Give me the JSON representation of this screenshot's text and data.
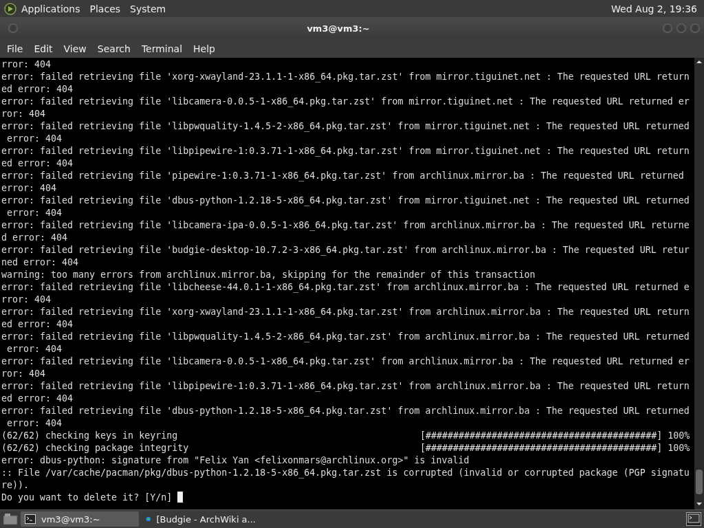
{
  "top_panel": {
    "menus": [
      "Applications",
      "Places",
      "System"
    ],
    "clock": "Wed Aug  2, 19:36"
  },
  "window": {
    "title": "vm3@vm3:~"
  },
  "menu_bar": [
    "File",
    "Edit",
    "View",
    "Search",
    "Terminal",
    "Help"
  ],
  "terminal": {
    "lines": [
      {
        "kind": "text",
        "text": "rror: 404"
      },
      {
        "kind": "text",
        "text": "error: failed retrieving file 'xorg-xwayland-23.1.1-1-x86_64.pkg.tar.zst' from mirror.tiguinet.net : The requested URL return"
      },
      {
        "kind": "text",
        "text": "ed error: 404"
      },
      {
        "kind": "text",
        "text": "error: failed retrieving file 'libcamera-0.0.5-1-x86_64.pkg.tar.zst' from mirror.tiguinet.net : The requested URL returned er"
      },
      {
        "kind": "text",
        "text": "ror: 404"
      },
      {
        "kind": "text",
        "text": "error: failed retrieving file 'libpwquality-1.4.5-2-x86_64.pkg.tar.zst' from mirror.tiguinet.net : The requested URL returned"
      },
      {
        "kind": "text",
        "text": " error: 404"
      },
      {
        "kind": "text",
        "text": "error: failed retrieving file 'libpipewire-1:0.3.71-1-x86_64.pkg.tar.zst' from mirror.tiguinet.net : The requested URL return"
      },
      {
        "kind": "text",
        "text": "ed error: 404"
      },
      {
        "kind": "text",
        "text": "error: failed retrieving file 'pipewire-1:0.3.71-1-x86_64.pkg.tar.zst' from archlinux.mirror.ba : The requested URL returned"
      },
      {
        "kind": "text",
        "text": "error: 404"
      },
      {
        "kind": "text",
        "text": "error: failed retrieving file 'dbus-python-1.2.18-5-x86_64.pkg.tar.zst' from mirror.tiguinet.net : The requested URL returned"
      },
      {
        "kind": "text",
        "text": " error: 404"
      },
      {
        "kind": "text",
        "text": "error: failed retrieving file 'libcamera-ipa-0.0.5-1-x86_64.pkg.tar.zst' from archlinux.mirror.ba : The requested URL returne"
      },
      {
        "kind": "text",
        "text": "d error: 404"
      },
      {
        "kind": "text",
        "text": "error: failed retrieving file 'budgie-desktop-10.7.2-3-x86_64.pkg.tar.zst' from archlinux.mirror.ba : The requested URL retur"
      },
      {
        "kind": "text",
        "text": "ned error: 404"
      },
      {
        "kind": "text",
        "text": "warning: too many errors from archlinux.mirror.ba, skipping for the remainder of this transaction"
      },
      {
        "kind": "text",
        "text": "error: failed retrieving file 'libcheese-44.0.1-1-x86_64.pkg.tar.zst' from archlinux.mirror.ba : The requested URL returned e"
      },
      {
        "kind": "text",
        "text": "rror: 404"
      },
      {
        "kind": "text",
        "text": "error: failed retrieving file 'xorg-xwayland-23.1.1-1-x86_64.pkg.tar.zst' from archlinux.mirror.ba : The requested URL return"
      },
      {
        "kind": "text",
        "text": "ed error: 404"
      },
      {
        "kind": "text",
        "text": "error: failed retrieving file 'libpwquality-1.4.5-2-x86_64.pkg.tar.zst' from archlinux.mirror.ba : The requested URL returned"
      },
      {
        "kind": "text",
        "text": " error: 404"
      },
      {
        "kind": "text",
        "text": "error: failed retrieving file 'libcamera-0.0.5-1-x86_64.pkg.tar.zst' from archlinux.mirror.ba : The requested URL returned er"
      },
      {
        "kind": "text",
        "text": "ror: 404"
      },
      {
        "kind": "text",
        "text": "error: failed retrieving file 'libpipewire-1:0.3.71-1-x86_64.pkg.tar.zst' from archlinux.mirror.ba : The requested URL return"
      },
      {
        "kind": "text",
        "text": "ed error: 404"
      },
      {
        "kind": "text",
        "text": "error: failed retrieving file 'dbus-python-1.2.18-5-x86_64.pkg.tar.zst' from archlinux.mirror.ba : The requested URL returned"
      },
      {
        "kind": "text",
        "text": " error: 404"
      },
      {
        "kind": "progress",
        "text": "(62/62) checking keys in keyring",
        "bar": "[##########################################]",
        "percent": "100%"
      },
      {
        "kind": "progress",
        "text": "(62/62) checking package integrity",
        "bar": "[##########################################]",
        "percent": "100%"
      },
      {
        "kind": "text",
        "text": "error: dbus-python: signature from \"Felix Yan <felixonmars@archlinux.org>\" is invalid"
      },
      {
        "kind": "text",
        "text": ":: File /var/cache/pacman/pkg/dbus-python-1.2.18-5-x86_64.pkg.tar.zst is corrupted (invalid or corrupted package (PGP signatu"
      },
      {
        "kind": "text",
        "text": "re))."
      },
      {
        "kind": "prompt",
        "text": "Do you want to delete it? [Y/n] "
      }
    ]
  },
  "taskbar": {
    "tasks": [
      {
        "label": "vm3@vm3:~",
        "kind": "terminal",
        "selected": true
      },
      {
        "label": "[Budgie - ArchWiki a...",
        "kind": "browser",
        "selected": false
      }
    ]
  }
}
